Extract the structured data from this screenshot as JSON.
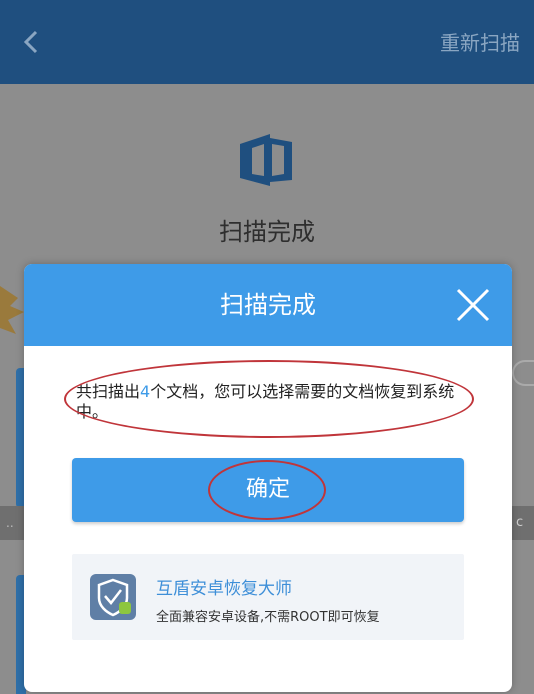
{
  "appbar": {
    "back_icon": "chevron-left-icon",
    "action_label": "重新扫描"
  },
  "background": {
    "doc_icon": "office-document-icon",
    "title": "扫描完成",
    "left_strip_text": "..",
    "right_strip_text": "c"
  },
  "dialog": {
    "title": "扫描完成",
    "close_icon": "close-icon",
    "message_prefix": "共扫描出",
    "message_count": "4",
    "message_suffix": "个文档，您可以选择需要的文档恢复到系统中。",
    "confirm_label": "确定",
    "promo": {
      "icon": "shield-android-icon",
      "name": "互盾安卓恢复大师",
      "description": "全面兼容安卓设备,不需ROOT即可恢复"
    }
  },
  "colors": {
    "accent": "#3e9be8",
    "appbar": "#1f4f7f",
    "annotation": "#c0353a"
  }
}
